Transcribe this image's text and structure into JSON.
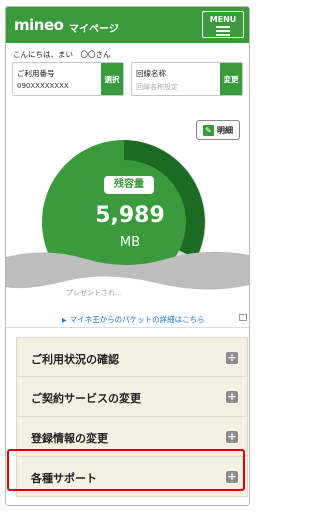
{
  "header": {
    "logo": "mineo",
    "title": "マイページ",
    "menu_label": "MENU"
  },
  "greeting": "こんにちは、まい　〇〇さん",
  "number_box": {
    "label": "ご利用番号",
    "value": "090XXXXXXXX",
    "button": "選択"
  },
  "line_box": {
    "label": "回線名称",
    "placeholder": "回線名称設定",
    "button": "変更"
  },
  "meisai_button": "明細",
  "gauge": {
    "label": "残容量",
    "value": "5,989",
    "unit": "MB",
    "colors": {
      "remaining": "#3a9b3c",
      "dark": "#1d6b22",
      "background": "#d9d9d9"
    }
  },
  "present_text": "プレゼントされ…",
  "detail_link": "マイネ王からのパケットの詳細はこちら",
  "menu": [
    {
      "label": "ご利用状況の確認"
    },
    {
      "label": "ご契約サービスの変更"
    },
    {
      "label": "登録情報の変更"
    },
    {
      "label": "各種サポート"
    }
  ]
}
